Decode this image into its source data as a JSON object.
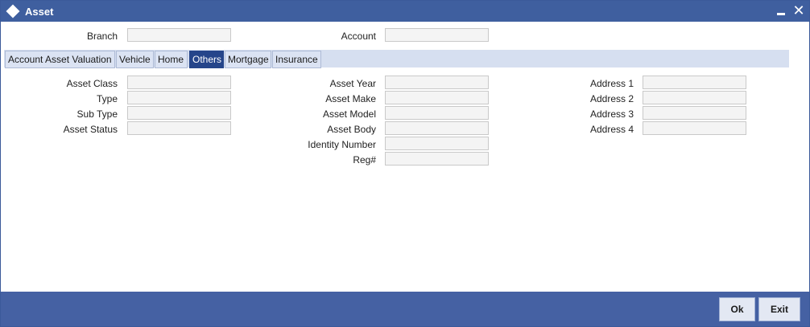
{
  "window": {
    "title": "Asset"
  },
  "header": {
    "branch_label": "Branch",
    "branch_value": "",
    "account_label": "Account",
    "account_value": ""
  },
  "tabs": [
    {
      "label": "Account Asset Valuation",
      "active": false
    },
    {
      "label": "Vehicle",
      "active": false
    },
    {
      "label": "Home",
      "active": false
    },
    {
      "label": "Others",
      "active": true
    },
    {
      "label": "Mortgage",
      "active": false
    },
    {
      "label": "Insurance",
      "active": false
    }
  ],
  "others": {
    "col1": [
      {
        "label": "Asset Class",
        "value": ""
      },
      {
        "label": "Type",
        "value": ""
      },
      {
        "label": "Sub Type",
        "value": ""
      },
      {
        "label": "Asset Status",
        "value": ""
      }
    ],
    "col2": [
      {
        "label": "Asset Year",
        "value": ""
      },
      {
        "label": "Asset Make",
        "value": ""
      },
      {
        "label": "Asset Model",
        "value": ""
      },
      {
        "label": "Asset Body",
        "value": ""
      },
      {
        "label": "Identity Number",
        "value": ""
      },
      {
        "label": "Reg#",
        "value": ""
      }
    ],
    "col3": [
      {
        "label": "Address 1",
        "value": ""
      },
      {
        "label": "Address 2",
        "value": ""
      },
      {
        "label": "Address 3",
        "value": ""
      },
      {
        "label": "Address 4",
        "value": ""
      }
    ]
  },
  "footer": {
    "ok_label": "Ok",
    "exit_label": "Exit"
  },
  "colors": {
    "titlebar": "#3f5f9f",
    "footer": "#4561a3",
    "active_tab": "#25458a",
    "tabbar": "#d6dff0"
  }
}
